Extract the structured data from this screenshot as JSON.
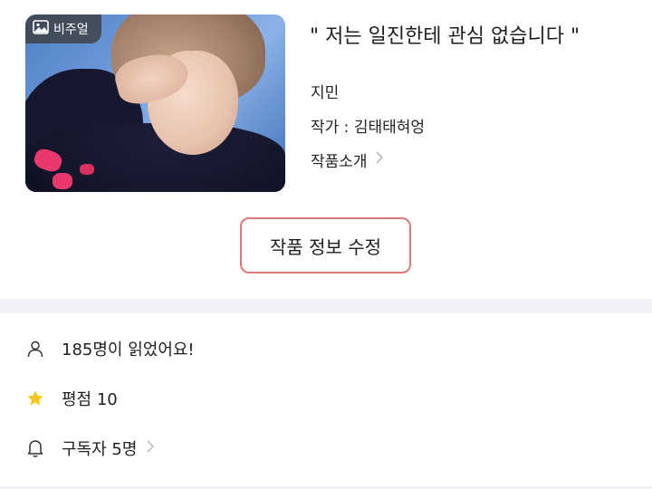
{
  "cover": {
    "badge_label": "비주얼",
    "badge_icon": "image-icon"
  },
  "work": {
    "title": "\" 저는 일진한테 관심 없습니다 \"",
    "main_character": "지민",
    "author_line": "작가 : 김태태혀엉",
    "intro_label": "작품소개",
    "intro_icon": "chevron-right-icon"
  },
  "actions": {
    "edit_label": "작품 정보 수정"
  },
  "stats": {
    "readers_text": "185명이 읽었어요!",
    "readers_icon": "person-icon",
    "rating_text": "평점 10",
    "rating_icon": "star-icon",
    "subscribers_text": "구독자 5명",
    "subscribers_icon": "bell-icon"
  },
  "colors": {
    "button_border": "#e07a7a",
    "star": "#f5c518",
    "band": "#f1f2f5"
  }
}
